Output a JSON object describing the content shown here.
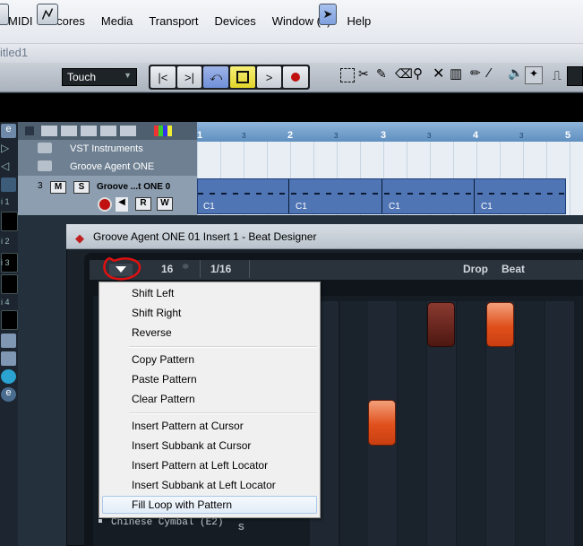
{
  "menubar": {
    "items": [
      "MIDI",
      "Scores",
      "Media",
      "Transport",
      "Devices",
      "Window (1)",
      "Help"
    ]
  },
  "project": {
    "title": "itled1"
  },
  "toolbar": {
    "automation_mode": "Touch"
  },
  "ruler": {
    "bars": [
      "1",
      "2",
      "3",
      "4",
      "5"
    ],
    "beats": [
      "3",
      "3",
      "3",
      "3"
    ]
  },
  "tracks": {
    "folder1": "VST Instruments",
    "folder2": "Groove Agent ONE",
    "instrument": {
      "number": "3",
      "mute": "M",
      "solo": "S",
      "name": "Groove ...t ONE 0",
      "read": "R",
      "write": "W"
    }
  },
  "part": {
    "labels": [
      "C1",
      "C1",
      "C1",
      "C1"
    ]
  },
  "plugin_window": {
    "title": "Groove Agent ONE 01 Insert 1 - Beat Designer",
    "steps": "16",
    "resolution": "1/16",
    "drop_label": "Drop",
    "beat_label": "Beat",
    "row_label": "Chinese Cymbal (E2)",
    "s_label": "S"
  },
  "context_menu": {
    "items": [
      "Shift Left",
      "Shift Right",
      "Reverse",
      "Copy Pattern",
      "Paste Pattern",
      "Clear Pattern",
      "Insert Pattern at Cursor",
      "Insert Subbank at Cursor",
      "Insert Pattern at Left Locator",
      "Insert Subbank at Left Locator",
      "Fill Loop with Pattern"
    ],
    "highlighted_index": 10
  },
  "colors": {
    "pad_dark_red": "#5a1b14",
    "pad_orange": "#e0501c",
    "annotation_red": "#e01010",
    "part_blue": "#4f75b5"
  }
}
